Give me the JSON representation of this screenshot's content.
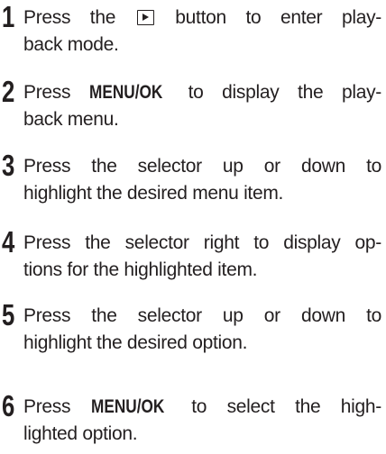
{
  "steps": [
    {
      "number": "1",
      "lines": {
        "a_before": "Press the",
        "a_after": "button to enter play-",
        "b": "back mode."
      },
      "icon": "playback-button-icon"
    },
    {
      "number": "2",
      "lines": {
        "a_before": "Press",
        "a_bold": "MENU/OK",
        "a_after": "to display the play-",
        "b": "back menu."
      }
    },
    {
      "number": "3",
      "lines": {
        "a": "Press the selector up or down to",
        "b": "highlight the desired menu item."
      }
    },
    {
      "number": "4",
      "lines": {
        "a": "Press the selector right to display op-",
        "b": "tions for the highlighted item."
      }
    },
    {
      "number": "5",
      "lines": {
        "a": "Press the selector up or down to",
        "b": "highlight the desired option."
      }
    },
    {
      "number": "6",
      "lines": {
        "a_before": "Press",
        "a_bold": "MENU/OK",
        "a_after": "to select the high-",
        "b": "lighted option."
      }
    }
  ]
}
